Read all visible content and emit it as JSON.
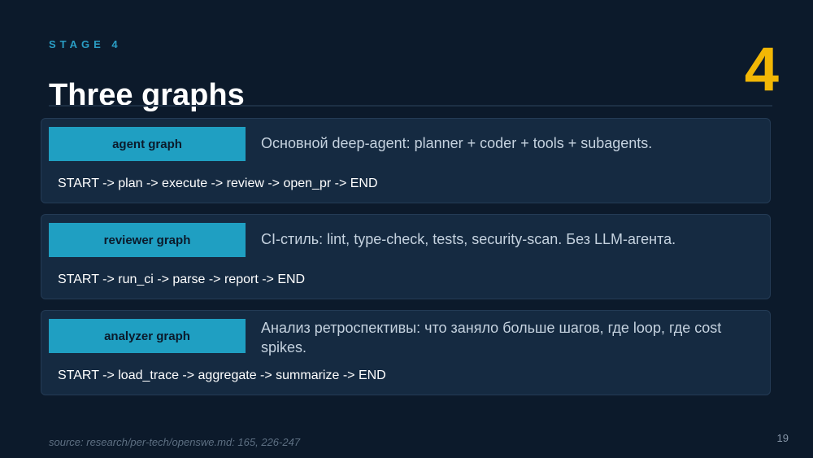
{
  "header": {
    "stage_label": "STAGE 4",
    "big_number": "4",
    "title": "Three graphs"
  },
  "graphs": [
    {
      "name": "agent graph",
      "description": "Основной deep-agent: planner + coder + tools + subagents.",
      "flow": "START -> plan -> execute -> review -> open_pr -> END"
    },
    {
      "name": "reviewer graph",
      "description": "CI-стиль: lint, type-check, tests, security-scan. Без LLM-агента.",
      "flow": "START -> run_ci -> parse -> report -> END"
    },
    {
      "name": "analyzer graph",
      "description": "Анализ ретроспективы: что заняло больше шагов, где loop, где cost spikes.",
      "flow": "START -> load_trace -> aggregate -> summarize -> END"
    }
  ],
  "footer": {
    "source": "source: research/per-tech/openswe.md: 165, 226-247",
    "page_number": "19"
  },
  "colors": {
    "background": "#0c1a2b",
    "accent_cyan": "#1f9fc2",
    "accent_yellow": "#f2b705",
    "card": "#152a41"
  }
}
